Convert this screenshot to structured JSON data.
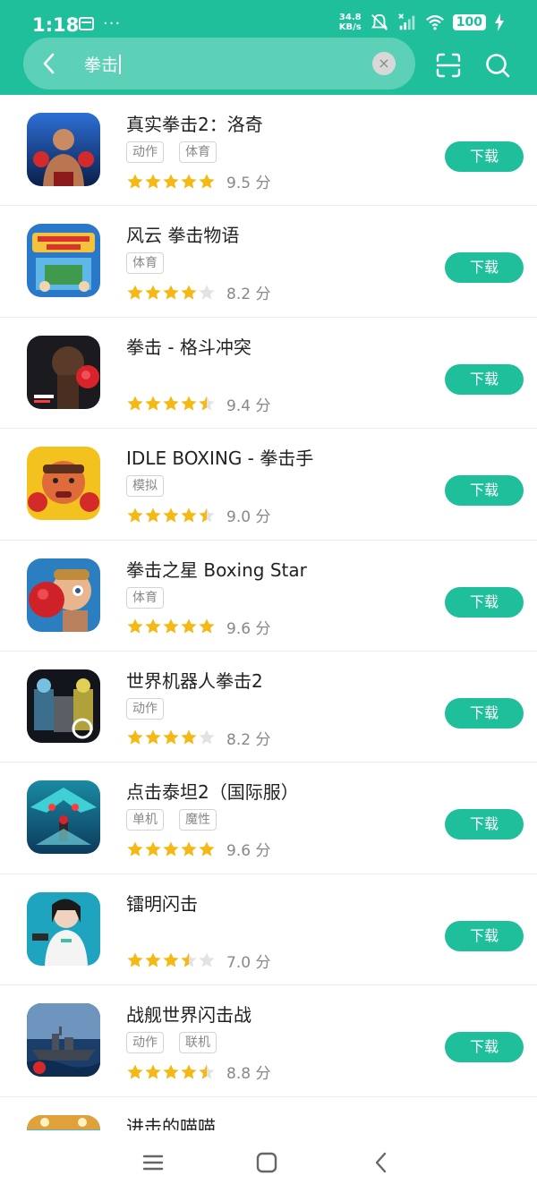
{
  "status_bar": {
    "time": "1:18",
    "more": "···",
    "net_speed_value": "34.8",
    "net_speed_unit": "KB/s",
    "battery": "100"
  },
  "search": {
    "query": "拳击"
  },
  "apps": [
    {
      "name": "真实拳击2：洛奇",
      "tags": [
        "动作",
        "体育"
      ],
      "rating": 5,
      "score": "9.5 分",
      "download": "下载"
    },
    {
      "name": "风云 拳击物语",
      "tags": [
        "体育"
      ],
      "rating": 4,
      "score": "8.2 分",
      "download": "下载"
    },
    {
      "name": "拳击 - 格斗冲突",
      "tags": [],
      "rating": 4.5,
      "score": "9.4 分",
      "download": "下载"
    },
    {
      "name": "IDLE BOXING - 拳击手",
      "tags": [
        "模拟"
      ],
      "rating": 4.5,
      "score": "9.0 分",
      "download": "下载"
    },
    {
      "name": "拳击之星 Boxing Star",
      "tags": [
        "体育"
      ],
      "rating": 5,
      "score": "9.6 分",
      "download": "下载"
    },
    {
      "name": "世界机器人拳击2",
      "tags": [
        "动作"
      ],
      "rating": 4,
      "score": "8.2 分",
      "download": "下载"
    },
    {
      "name": "点击泰坦2（国际服）",
      "tags": [
        "单机",
        "魔性"
      ],
      "rating": 5,
      "score": "9.6 分",
      "download": "下载"
    },
    {
      "name": "镭明闪击",
      "tags": [],
      "rating": 3.5,
      "score": "7.0 分",
      "download": "下载"
    },
    {
      "name": "战舰世界闪击战",
      "tags": [
        "动作",
        "联机"
      ],
      "rating": 4.5,
      "score": "8.8 分",
      "download": "下载"
    },
    {
      "name": "进击的喵喵",
      "tags": [],
      "rating": 0,
      "score": "",
      "download": ""
    }
  ],
  "colors": {
    "accent": "#1fbf9c",
    "star": "#f5b915",
    "star_empty": "#e3e3e3"
  },
  "nav": {
    "icons": [
      "menu-icon",
      "home-icon",
      "back-icon"
    ]
  }
}
